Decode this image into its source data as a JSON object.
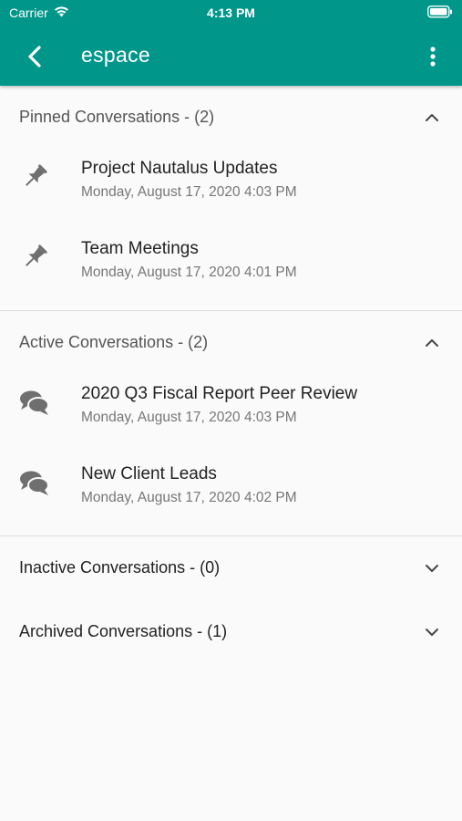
{
  "status_bar": {
    "carrier": "Carrier",
    "time": "4:13 PM"
  },
  "header": {
    "title": "espace",
    "back_icon": "chevron-left-icon",
    "more_icon": "more-vertical-icon"
  },
  "colors": {
    "primary": "#00968a",
    "background": "#fafafa",
    "icon_gray": "#6f6f6f"
  },
  "sections": {
    "pinned": {
      "label": "Pinned Conversations - (2)",
      "expanded": true,
      "items": [
        {
          "name": "Project Nautalus Updates",
          "date": "Monday, August 17, 2020 4:03 PM",
          "icon": "pin-icon"
        },
        {
          "name": "Team Meetings",
          "date": "Monday, August 17, 2020 4:01 PM",
          "icon": "pin-icon"
        }
      ]
    },
    "active": {
      "label": "Active Conversations - (2)",
      "expanded": true,
      "items": [
        {
          "name": "2020 Q3 Fiscal Report Peer Review",
          "date": "Monday, August 17, 2020 4:03 PM",
          "icon": "chat-bubbles-icon"
        },
        {
          "name": "New Client Leads",
          "date": "Monday, August 17, 2020 4:02 PM",
          "icon": "chat-bubbles-icon"
        }
      ]
    },
    "inactive": {
      "label": "Inactive Conversations - (0)",
      "expanded": false
    },
    "archived": {
      "label": "Archived Conversations - (1)",
      "expanded": false
    }
  }
}
